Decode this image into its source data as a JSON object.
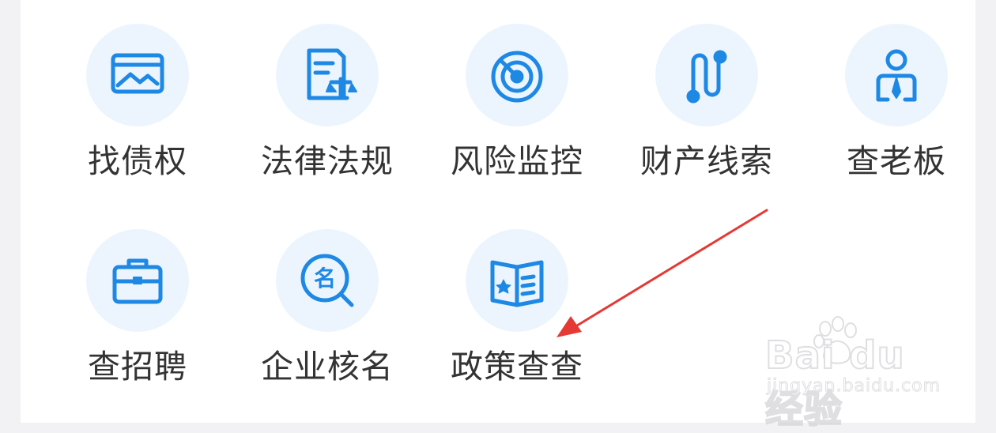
{
  "menu": {
    "row1": [
      {
        "label": "找债权",
        "icon": "debt-image-icon"
      },
      {
        "label": "法律法规",
        "icon": "law-document-icon"
      },
      {
        "label": "风险监控",
        "icon": "radar-icon"
      },
      {
        "label": "财产线索",
        "icon": "route-path-icon"
      },
      {
        "label": "查老板",
        "icon": "boss-person-icon"
      }
    ],
    "row2": [
      {
        "label": "查招聘",
        "icon": "briefcase-icon"
      },
      {
        "label": "企业核名",
        "icon": "name-search-icon"
      },
      {
        "label": "政策查查",
        "icon": "policy-book-icon"
      }
    ]
  },
  "watermark": {
    "brand": "Bai du 经验",
    "url": "jingyan.baidu.com"
  },
  "colors": {
    "accent": "#1e88e5",
    "icon_bg": "#ecf5fe",
    "label": "#333333",
    "arrow": "#e53935"
  }
}
